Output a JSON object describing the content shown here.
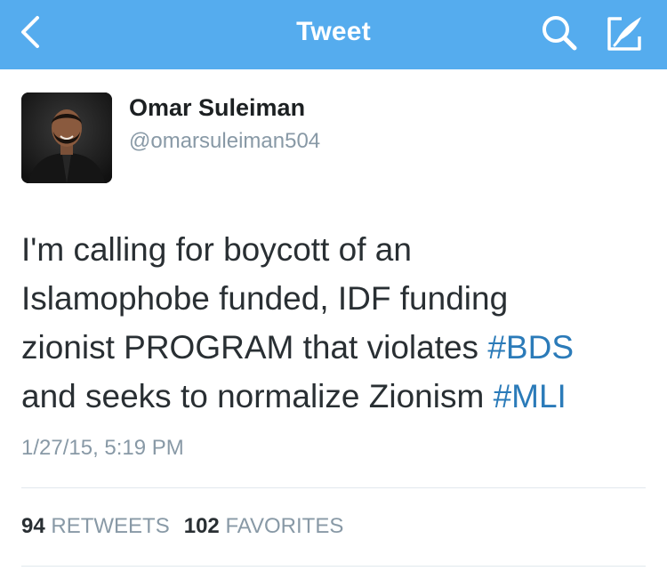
{
  "colors": {
    "navbar_bg": "#55acee",
    "link": "#2b7bb9",
    "secondary_text": "#8899a6"
  },
  "navbar": {
    "title": "Tweet",
    "back_icon": "chevron-left-icon",
    "search_icon": "search-icon",
    "compose_icon": "compose-icon"
  },
  "tweet": {
    "author_name": "Omar Suleiman",
    "author_handle": "@omarsuleiman504",
    "lines": [
      {
        "text": "I'm calling for boycott of an"
      },
      {
        "text": "Islamophobe funded, IDF funding"
      },
      {
        "text": "zionist PROGRAM that violates ",
        "hashtag": "#BDS"
      },
      {
        "text": "and seeks to normalize Zionism ",
        "hashtag": "#MLI"
      }
    ],
    "timestamp": "1/27/15, 5:19 PM"
  },
  "stats": {
    "retweets_count": "94",
    "retweets_label": "RETWEETS",
    "favorites_count": "102",
    "favorites_label": "FAVORITES"
  }
}
